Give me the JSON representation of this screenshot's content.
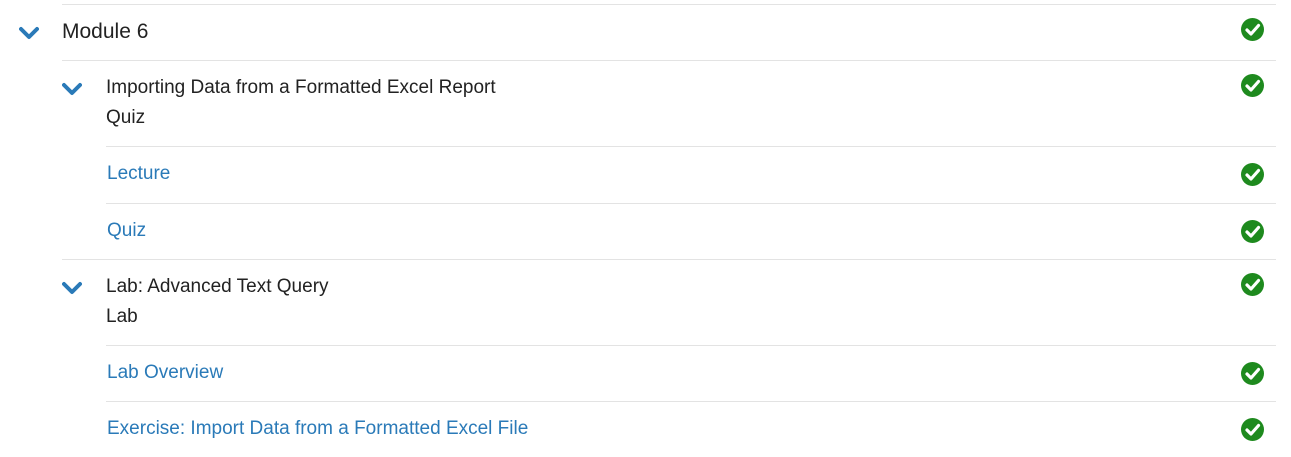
{
  "module": {
    "title": "Module 6",
    "expand_icon": "chevron-down-icon",
    "status_icon": "check-circle-icon"
  },
  "sections": [
    {
      "title": "Importing Data from a Formatted Excel Report",
      "type": "Quiz",
      "expand_icon": "chevron-down-icon",
      "status_icon": "check-circle-icon",
      "items": [
        {
          "label": "Lecture",
          "status_icon": "check-circle-icon"
        },
        {
          "label": "Quiz",
          "status_icon": "check-circle-icon"
        }
      ]
    },
    {
      "title": "Lab: Advanced Text Query",
      "type": "Lab",
      "expand_icon": "chevron-down-icon",
      "status_icon": "check-circle-icon",
      "items": [
        {
          "label": "Lab Overview",
          "status_icon": "check-circle-icon"
        },
        {
          "label": "Exercise: Import Data from a Formatted Excel File",
          "status_icon": "check-circle-icon"
        }
      ]
    }
  ],
  "colors": {
    "accent": "#2a7ab8",
    "complete": "#1e8a1e",
    "text": "#222222",
    "divider": "#e3e3e3"
  }
}
